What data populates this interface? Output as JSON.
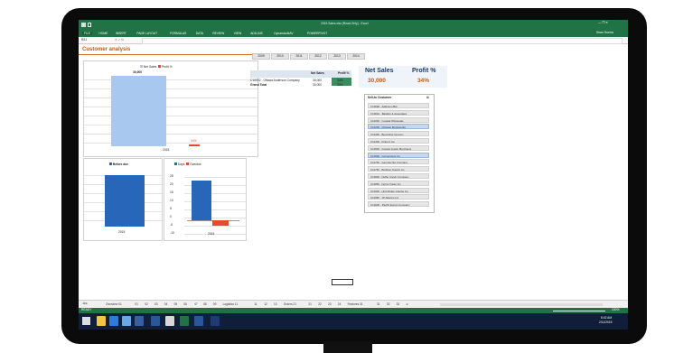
{
  "window": {
    "title": "2015 Sales.xlsx [Read-Only] - Excel",
    "user": "Sean Guerra"
  },
  "ribbon": {
    "tabs": [
      "FILE",
      "HOME",
      "INSERT",
      "PAGE LAYOUT",
      "FORMULAS",
      "DATA",
      "REVIEW",
      "VIEW",
      "ADD-INS",
      "DynamicsNAV",
      "POWERPIVOT"
    ]
  },
  "formula_bar": {
    "name_box": "R21",
    "value": ""
  },
  "sheet": {
    "title": "Customer analysis",
    "year_slicer": [
      "2009",
      "2010",
      "2011",
      "2012",
      "2013",
      "2014"
    ],
    "pivot": {
      "headers": [
        "Net Sales",
        "Profit %"
      ],
      "rows": [
        {
          "label": "C10002 - Ottawa Anderson Company",
          "net": "30,000",
          "pct": "34%"
        },
        {
          "label": "Grand Total",
          "net": "30,000",
          "pct": "34%"
        }
      ]
    },
    "kpi": {
      "net_sales_label": "Net Sales",
      "net_sales_value": "30,000",
      "profit_label": "Profit %",
      "profit_value": "34%"
    },
    "customer_slicer": {
      "title": "Sell-to Customer",
      "items": [
        "C10000 - Adkinson Bar",
        "C10010 - Baldwin & Associates",
        "C11000 - Coastal Wholesale",
        "C11200 - Chicago Motorworks",
        "C11300 - Beveridge Grocery",
        "C11400 - Finley's Inc",
        "C11500 - Greater Austin Merchants",
        "C11600 - Cornerstone Co",
        "C11700 - Georgia Nut Company",
        "C11750 - Brighton Supply Co",
        "C11800 - Nuffer Candy Company",
        "C11850 - Norris Trailer Inc",
        "C11900 - High Ridge Granite Co",
        "C11950 - JP Alliance Inc",
        "C12000 - Pacific Export Company"
      ],
      "selected": [
        3,
        7
      ]
    }
  },
  "chart_data": [
    {
      "type": "bar",
      "legend": [
        "Net Sales",
        "Profit %"
      ],
      "categories": [
        "2015"
      ],
      "series": [
        {
          "name": "Net Sales",
          "values": [
            30000
          ]
        },
        {
          "name": "Profit %",
          "values": [
            0.34
          ]
        }
      ],
      "data_labels": [
        "30,000",
        "34%"
      ],
      "color_primary": "#a9c8ef",
      "color_secondary": "#e84a2f"
    },
    {
      "type": "bar",
      "legend": [
        "Before due"
      ],
      "categories": [
        "2015"
      ],
      "series": [
        {
          "name": "Before due",
          "values": [
            30000
          ]
        }
      ],
      "color": "#2766b8"
    },
    {
      "type": "bar",
      "legend": [
        "Days",
        "Overdue"
      ],
      "categories": [
        "2015"
      ],
      "series": [
        {
          "name": "Days",
          "values": [
            20
          ]
        },
        {
          "name": "Overdue",
          "values": [
            -3
          ]
        }
      ],
      "tick_labels": [
        "25",
        "20",
        "15",
        "10",
        "5",
        "0",
        "-5",
        "-10"
      ],
      "color_primary": "#2766b8",
      "color_secondary": "#e84a2f"
    }
  ],
  "sheet_tabs": [
    "Overview 01",
    "01",
    "02",
    "03",
    "04",
    "05",
    "06",
    "07",
    "08",
    "09",
    "Logistics 11",
    "11",
    "12",
    "13",
    "Orders 21",
    "21",
    "22",
    "23",
    "24",
    "Features 31",
    "31",
    "32",
    "33"
  ],
  "active_sheet_tab": "07",
  "status": {
    "left": "READY",
    "zoom": "100%"
  },
  "taskbar": {
    "time": "8:42 AM",
    "date": "2/11/2015"
  }
}
